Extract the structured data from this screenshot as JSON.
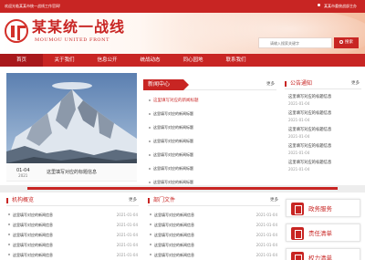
{
  "topbar": {
    "welcome": "欢迎光临某某市统一战线工作官网!",
    "right_link": "某某市委统战部主办"
  },
  "header": {
    "logo_cn": "某某统一战线",
    "logo_en": "MOUMOU UNITED FRONT",
    "search_placeholder": "请输入搜索关键字",
    "search_button": "搜索"
  },
  "nav": {
    "items": [
      "首页",
      "关于我们",
      "信息公开",
      "统战动态",
      "同心园地",
      "联系我们"
    ]
  },
  "focus": {
    "caption_date": "01-04",
    "caption_year": "2021",
    "caption_text": "这里填写对应的标题信息"
  },
  "news": {
    "title": "新闻中心",
    "more": "更多",
    "items": [
      "这里填写对应的新闻标题",
      "这里填写对应的新闻标题",
      "这里填写对应的新闻标题",
      "这里填写对应的新闻标题",
      "这里填写对应的新闻标题",
      "这里填写对应的新闻标题",
      "这里填写对应的新闻标题"
    ]
  },
  "notice": {
    "title": "公告通知",
    "more": "更多",
    "items": [
      {
        "title": "这里填写对应的标题信息",
        "date": "2021-01-04"
      },
      {
        "title": "这里填写对应的标题信息",
        "date": "2021-01-04"
      },
      {
        "title": "这里填写对应的标题信息",
        "date": "2021-01-04"
      },
      {
        "title": "这里填写对应的标题信息",
        "date": "2021-01-04"
      },
      {
        "title": "这里填写对应的标题信息",
        "date": "2021-01-04"
      }
    ]
  },
  "org": {
    "title": "机构概览",
    "more": "更多",
    "items": [
      {
        "title": "这里填写对应的新闻信息",
        "date": "2021-01-04"
      },
      {
        "title": "这里填写对应的新闻信息",
        "date": "2021-01-04"
      },
      {
        "title": "这里填写对应的新闻信息",
        "date": "2021-01-04"
      },
      {
        "title": "这里填写对应的新闻信息",
        "date": "2021-01-04"
      },
      {
        "title": "这里填写对应的新闻信息",
        "date": "2021-01-04"
      }
    ]
  },
  "dept": {
    "title": "部门文件",
    "more": "更多",
    "items": [
      {
        "title": "这里填写对应的新闻信息",
        "date": "2021-01-04"
      },
      {
        "title": "这里填写对应的新闻信息",
        "date": "2021-01-04"
      },
      {
        "title": "这里填写对应的新闻信息",
        "date": "2021-01-04"
      },
      {
        "title": "这里填写对应的新闻信息",
        "date": "2021-01-04"
      },
      {
        "title": "这里填写对应的新闻信息",
        "date": "2021-01-04"
      }
    ]
  },
  "services": [
    "政务服务",
    "责任清单",
    "权力清单"
  ],
  "colors": {
    "brand_red": "#c82523",
    "nav_active": "#a8181b"
  }
}
